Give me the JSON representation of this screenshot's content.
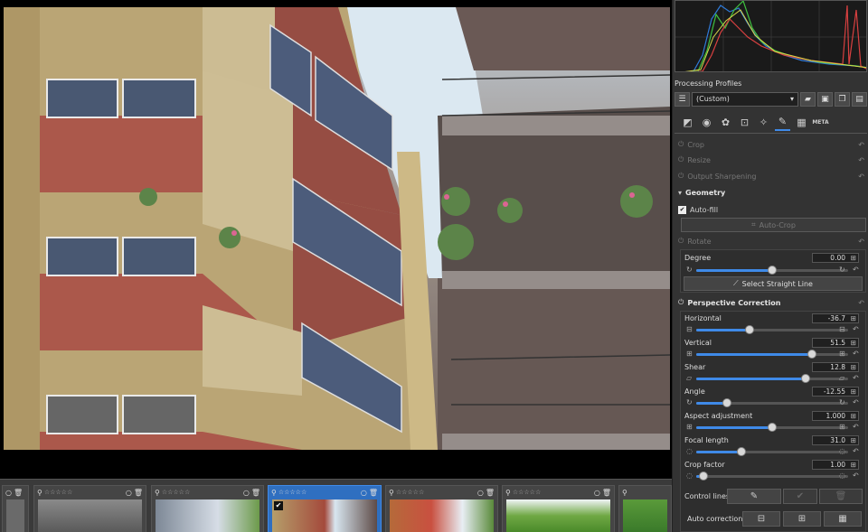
{
  "colors": {
    "accent": "#3f8ae8",
    "panel": "#333333",
    "filmstrip_selected": "#2f6fc0"
  },
  "processing_profiles": {
    "title": "Processing Profiles",
    "selected": "(Custom)",
    "buttons": [
      "folder-open-icon",
      "save-icon",
      "copy-icon",
      "paste-icon"
    ]
  },
  "tool_tabs": [
    {
      "icon": "exposure-tab-icon",
      "glyph": "◩"
    },
    {
      "icon": "detail-tab-icon",
      "glyph": "◉"
    },
    {
      "icon": "color-tab-icon",
      "glyph": "✿"
    },
    {
      "icon": "advanced-tab-icon",
      "glyph": "⊡"
    },
    {
      "icon": "local-tab-icon",
      "glyph": "✧"
    },
    {
      "icon": "transform-tab-icon",
      "glyph": "✎"
    },
    {
      "icon": "raw-tab-icon",
      "glyph": "▦"
    },
    {
      "icon": "meta-tab-icon",
      "glyph": "META"
    }
  ],
  "tools": {
    "crop": "Crop",
    "resize": "Resize",
    "output_sharpening": "Output Sharpening",
    "geometry": "Geometry",
    "auto_fill": "Auto-fill",
    "auto_crop": "Auto-Crop",
    "rotate": "Rotate",
    "degree_label": "Degree",
    "degree_value": "0.00",
    "select_straight_line": "Select Straight Line",
    "perspective": "Perspective Correction"
  },
  "sliders": [
    {
      "label": "Horizontal",
      "value": "-36.7",
      "fraction": 0.35
    },
    {
      "label": "Vertical",
      "value": "51.5",
      "fraction": 0.76
    },
    {
      "label": "Shear",
      "value": "12.8",
      "fraction": 0.72
    },
    {
      "label": "Angle",
      "value": "-12.55",
      "fraction": 0.2
    },
    {
      "label": "Aspect adjustment",
      "value": "1.000",
      "fraction": 0.5
    },
    {
      "label": "Focal length",
      "value": "31.0",
      "fraction": 0.3
    },
    {
      "label": "Crop factor",
      "value": "1.00",
      "fraction": 0.05
    }
  ],
  "control_lines": "Control lines:",
  "auto_correction": "Auto correction:",
  "filmstrip": {
    "stars": "☆☆☆☆☆",
    "thumbs": [
      {
        "selected": false
      },
      {
        "selected": false
      },
      {
        "selected": false
      },
      {
        "selected": true
      },
      {
        "selected": false
      },
      {
        "selected": false
      },
      {
        "selected": false
      }
    ]
  }
}
